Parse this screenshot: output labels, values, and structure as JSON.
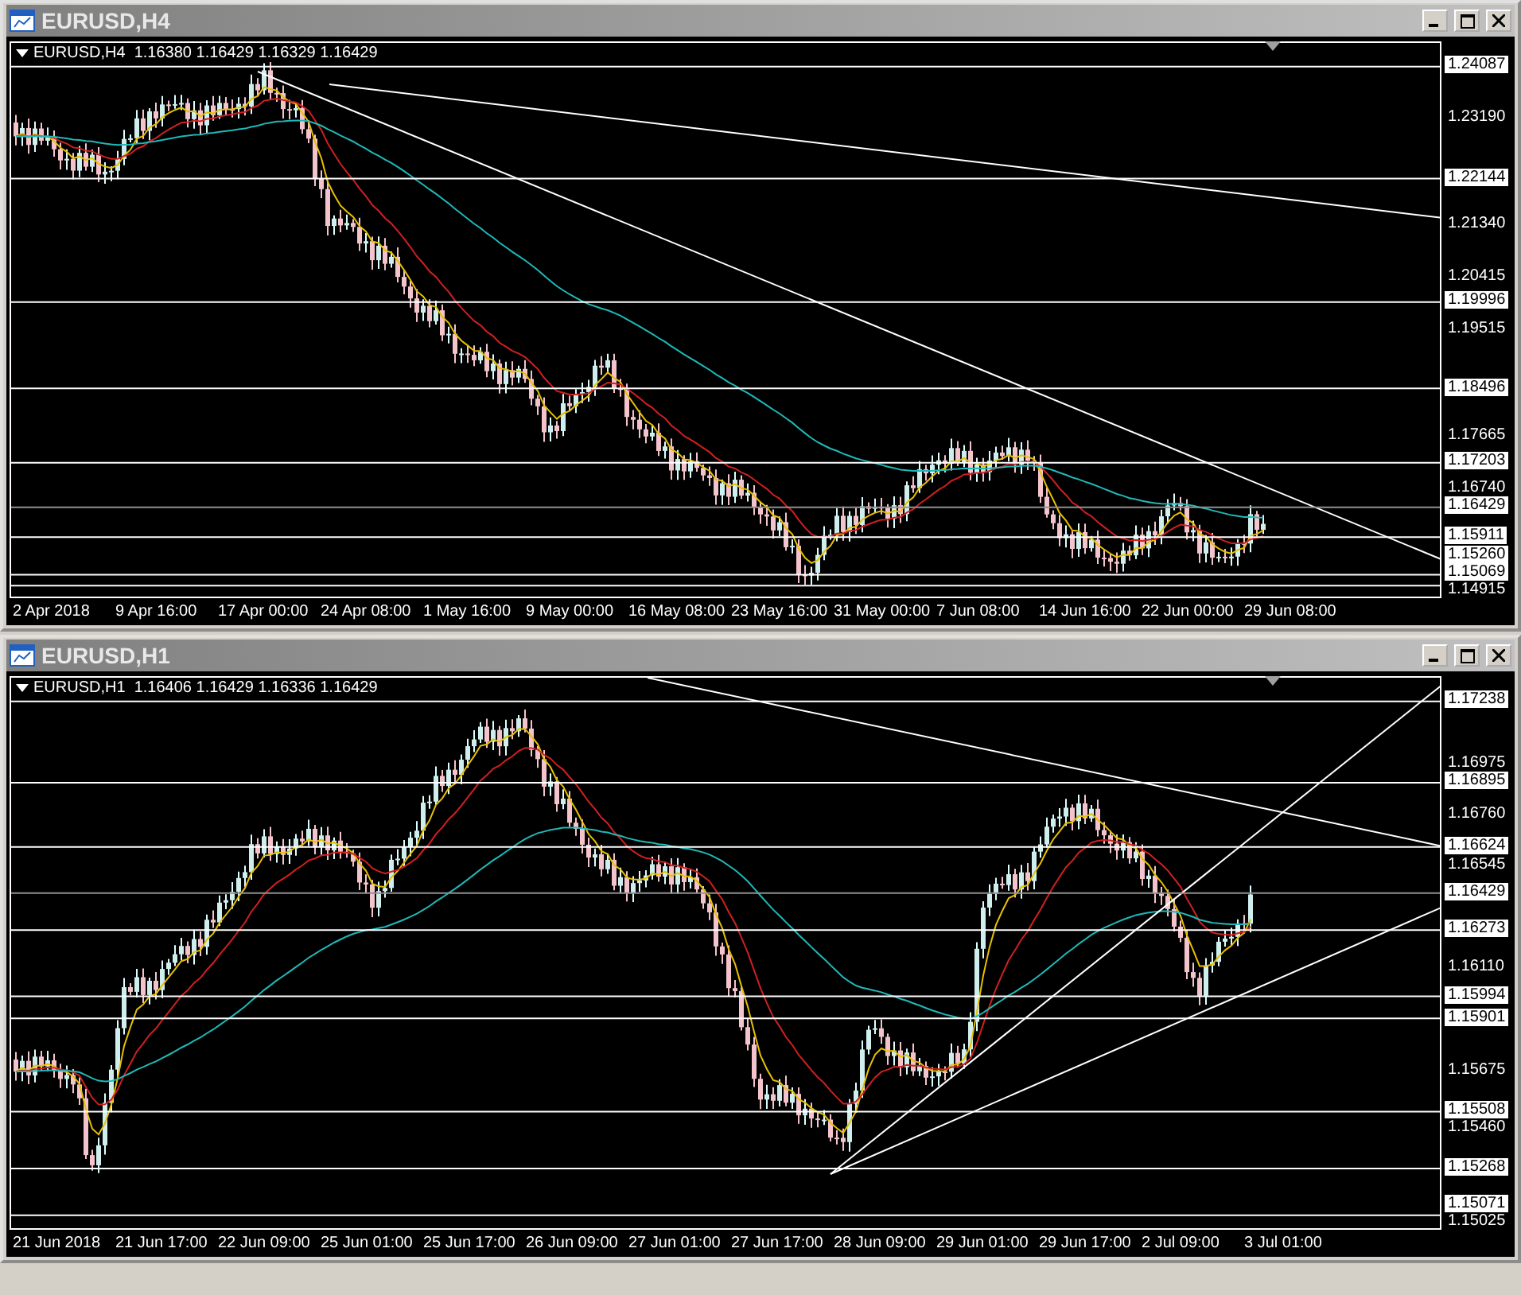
{
  "windows": [
    {
      "title": "EURUSD,H4",
      "info": "EURUSD,H4  1.16380 1.16429 1.16329 1.16429",
      "price_labels": [
        {
          "text": "1.24087",
          "kind": "level"
        },
        {
          "text": "1.23190",
          "kind": "tick"
        },
        {
          "text": "1.22144",
          "kind": "level"
        },
        {
          "text": "1.21340",
          "kind": "tick"
        },
        {
          "text": "1.20415",
          "kind": "tick"
        },
        {
          "text": "1.19996",
          "kind": "level"
        },
        {
          "text": "1.19515",
          "kind": "tick"
        },
        {
          "text": "1.18496",
          "kind": "level"
        },
        {
          "text": "1.17665",
          "kind": "tick"
        },
        {
          "text": "1.17203",
          "kind": "level"
        },
        {
          "text": "1.16740",
          "kind": "tick"
        },
        {
          "text": "1.16429",
          "kind": "bid"
        },
        {
          "text": "1.15911",
          "kind": "level"
        },
        {
          "text": "1.15260",
          "kind": "level"
        },
        {
          "text": "1.15069",
          "kind": "level"
        },
        {
          "text": "1.14915",
          "kind": "tick"
        }
      ],
      "time_labels": [
        "2 Apr 2018",
        "9 Apr 16:00",
        "17 Apr 00:00",
        "24 Apr 08:00",
        "1 May 16:00",
        "9 May 00:00",
        "16 May 08:00",
        "23 May 16:00",
        "31 May 00:00",
        "7 Jun 08:00",
        "14 Jun 16:00",
        "22 Jun 00:00",
        "29 Jun 08:00"
      ]
    },
    {
      "title": "EURUSD,H1",
      "info": "EURUSD,H1  1.16406 1.16429 1.16336 1.16429",
      "price_labels": [
        {
          "text": "1.17238",
          "kind": "level"
        },
        {
          "text": "1.16975",
          "kind": "tick"
        },
        {
          "text": "1.16895",
          "kind": "level"
        },
        {
          "text": "1.16760",
          "kind": "tick"
        },
        {
          "text": "1.16624",
          "kind": "level"
        },
        {
          "text": "1.16545",
          "kind": "tick"
        },
        {
          "text": "1.16429",
          "kind": "bid"
        },
        {
          "text": "1.16273",
          "kind": "level"
        },
        {
          "text": "1.16110",
          "kind": "tick"
        },
        {
          "text": "1.15994",
          "kind": "level"
        },
        {
          "text": "1.15901",
          "kind": "level"
        },
        {
          "text": "1.15675",
          "kind": "tick"
        },
        {
          "text": "1.15508",
          "kind": "level"
        },
        {
          "text": "1.15460",
          "kind": "tick"
        },
        {
          "text": "1.15268",
          "kind": "level"
        },
        {
          "text": "1.15071",
          "kind": "level"
        },
        {
          "text": "1.15025",
          "kind": "tick"
        }
      ],
      "time_labels": [
        "21 Jun 2018",
        "21 Jun 17:00",
        "22 Jun 09:00",
        "25 Jun 01:00",
        "25 Jun 17:00",
        "26 Jun 09:00",
        "27 Jun 01:00",
        "27 Jun 17:00",
        "28 Jun 09:00",
        "29 Jun 01:00",
        "29 Jun 17:00",
        "2 Jul 09:00",
        "3 Jul 01:00"
      ]
    }
  ]
}
